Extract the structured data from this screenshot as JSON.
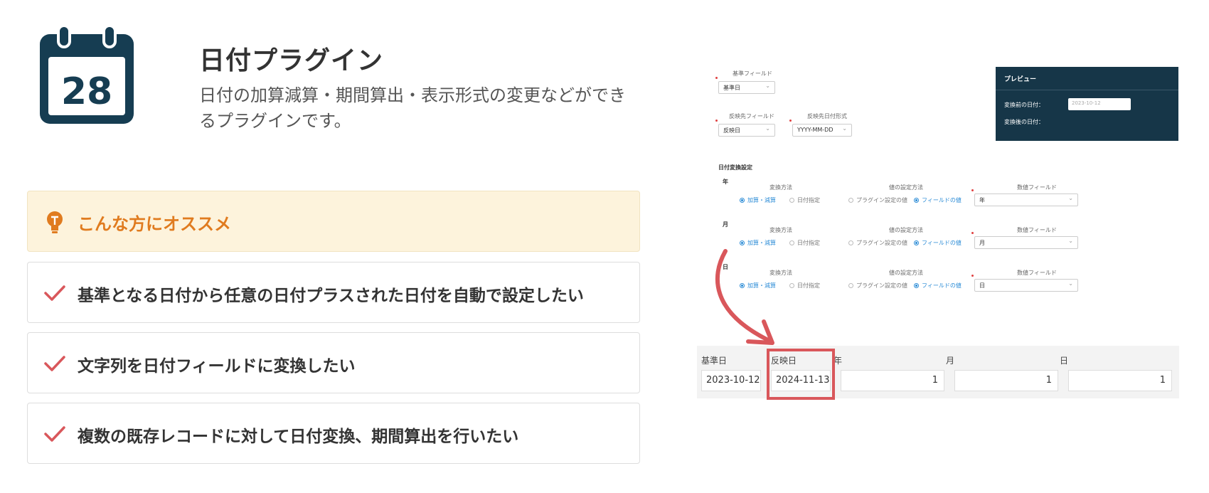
{
  "header": {
    "icon_name": "calendar-icon",
    "icon_day": "28",
    "title": "日付プラグイン",
    "description": "日付の加算減算・期間算出・表示形式の変更などができるプラグインです。"
  },
  "recommend": {
    "icon_name": "lightbulb-icon",
    "title": "こんな方にオススメ",
    "items": [
      "基準となる日付から任意の日付プラスされた日付を自動で設定したい",
      "文字列を日付フィールドに変換したい",
      "複数の既存レコードに対して日付変換、期間算出を行いたい"
    ]
  },
  "screenshot": {
    "base_field_label": "基準フィールド",
    "base_field_value": "基準日",
    "target_field_label": "反映先フィールド",
    "target_field_value": "反映日",
    "format_label": "反映先日付形式",
    "format_value": "YYYY-MM-DD",
    "section_title": "日付変換設定",
    "rows": [
      {
        "unit": "年",
        "method_label": "変換方法",
        "opt1": "加算・減算",
        "opt2": "日付指定",
        "value_label": "値の設定方法",
        "opt3": "プラグイン設定の値",
        "opt4": "フィールドの値",
        "num_label": "数値フィールド",
        "num_value": "年"
      },
      {
        "unit": "月",
        "method_label": "変換方法",
        "opt1": "加算・減算",
        "opt2": "日付指定",
        "value_label": "値の設定方法",
        "opt3": "プラグイン設定の値",
        "opt4": "フィールドの値",
        "num_label": "数値フィールド",
        "num_value": "月"
      },
      {
        "unit": "日",
        "method_label": "変換方法",
        "opt1": "加算・減算",
        "opt2": "日付指定",
        "value_label": "値の設定方法",
        "opt3": "プラグイン設定の値",
        "opt4": "フィールドの値",
        "num_label": "数値フィールド",
        "num_value": "日"
      }
    ],
    "preview": {
      "title": "プレビュー",
      "before_label": "変換前の日付：",
      "before_value": "2023-10-12",
      "after_label": "変換後の日付："
    },
    "result": {
      "headers": [
        "基準日",
        "反映日",
        "年",
        "月",
        "日"
      ],
      "values": [
        "2023-10-12",
        "2024-11-13",
        "1",
        "1",
        "1"
      ]
    },
    "accent_color": "#d9575b"
  }
}
